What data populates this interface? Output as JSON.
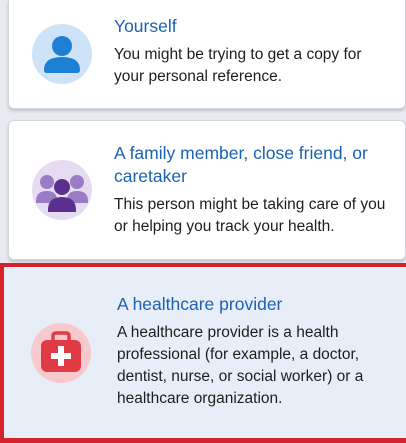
{
  "options": [
    {
      "title": "Yourself",
      "description": "You might be trying to get a copy for your personal reference.",
      "icon": "person-icon",
      "selected": false
    },
    {
      "title": "A family member, close friend, or caretaker",
      "description": "This person might be taking care of you or helping you track your health.",
      "icon": "group-icon",
      "selected": false
    },
    {
      "title": "A healthcare provider",
      "description": "A healthcare provider is a health professional (for example, a doctor, dentist, nurse, or social worker) or a healthcare organization.",
      "icon": "medical-bag-icon",
      "selected": true
    }
  ],
  "colors": {
    "title": "#1b62b0",
    "selection_border": "#d2232e",
    "selected_background": "#e7eef8",
    "person_icon": "#1e7fd6",
    "group_icon": "#6b3fa0",
    "medical_icon": "#e03a44"
  }
}
